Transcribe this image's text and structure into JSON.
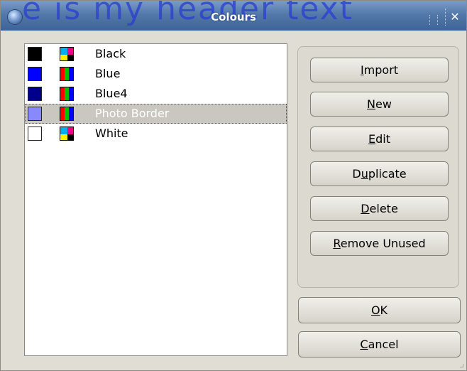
{
  "window": {
    "title": "Colours",
    "header_overlay_text": "e is my header text",
    "close_glyph": "✕"
  },
  "colors": {
    "titlebar": "#5379aa",
    "selection": "#c9c7bf",
    "dialog_bg": "#e0ddd5"
  },
  "colour_list": {
    "items": [
      {
        "name": "Black",
        "swatch": "#000000",
        "type_icon": "cmyk-icon",
        "selected": false
      },
      {
        "name": "Blue",
        "swatch": "#0000ff",
        "type_icon": "rgb-icon",
        "selected": false
      },
      {
        "name": "Blue4",
        "swatch": "#00008b",
        "type_icon": "rgb-icon",
        "selected": false
      },
      {
        "name": "Photo Border",
        "swatch": "#8888ff",
        "type_icon": "rgb-icon",
        "selected": true
      },
      {
        "name": "White",
        "swatch": "#ffffff",
        "type_icon": "cmyk-icon",
        "selected": false
      }
    ]
  },
  "buttons": {
    "import": {
      "before": "",
      "mnemonic": "I",
      "after": "mport"
    },
    "new": {
      "before": "",
      "mnemonic": "N",
      "after": "ew"
    },
    "edit": {
      "before": "",
      "mnemonic": "E",
      "after": "dit"
    },
    "duplicate": {
      "before": "D",
      "mnemonic": "u",
      "after": "plicate"
    },
    "delete": {
      "before": "",
      "mnemonic": "D",
      "after": "elete"
    },
    "remove_unused": {
      "before": "",
      "mnemonic": "R",
      "after": "emove Unused"
    },
    "ok": {
      "before": "",
      "mnemonic": "O",
      "after": "K"
    },
    "cancel": {
      "before": "",
      "mnemonic": "C",
      "after": "ancel"
    }
  }
}
